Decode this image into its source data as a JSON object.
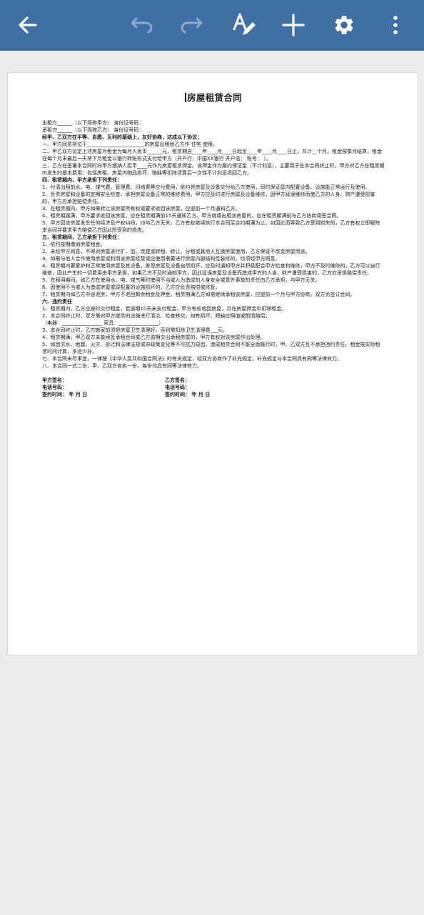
{
  "toolbar": {
    "icons": [
      "back-arrow-icon",
      "undo-icon",
      "redo-icon",
      "text-format-icon",
      "add-icon",
      "gear-icon",
      "more-vert-icon"
    ],
    "color": "#3f6fa3"
  },
  "document": {
    "title": "房屋租赁合同",
    "lines": [
      {
        "t": "出租方______（以下简称甲方）  身份证号码：",
        "b": false
      },
      {
        "t": "承租方______（以下简称乙方）  身份证号码：",
        "b": false
      },
      {
        "t": "经甲、乙双方在平等、自愿、互利的基础上，友好协商，达成以下协议：",
        "b": true
      },
      {
        "t": "一、甲方同意将位于_______________________的房屋出租给乙方作 住宅 使用。",
        "b": false
      },
      {
        "t": "二、甲乙双方议定上述房屋月租金为每月人民币______元，租赁期自____年____月____日起至____年____月____日止，共计__个月。租金按季月结算，租金在每个月末最后一天将下月租金以银行转账形式支付给甲方（开户行：中国XX银行  开户名：    账号：                ）。",
        "b": false
      },
      {
        "t": "三、乙方在签署本合同时向甲方缴纳人民币____元作为房屋租赁押金。该押金作为履约保证金（不计利息），主要用于在本合同终止时，甲方对乙方在租赁期内发生的基本费用：包括房租、房屋内物品损坏、赔缺等扣除清算后一次性不计利息退回乙方。",
        "b": false
      },
      {
        "t": "四、租赁期内，甲方承担下列责任：",
        "b": true
      },
      {
        "t": "1、付清出租前水、电、煤气费、管理费、间络费等应付费用，依约将房屋及设备交付给乙方使用，同时保证屋内配置设备、设施能正常运行及使用。",
        "b": false
      },
      {
        "t": "2、负责房屋和设备的定期安全检查，承担房屋设备正常的维修费用。甲方应及时进行房屋及设备维修，因甲方延误维修而使乙方的人身、财产遭受损害的，甲方应承担赔偿责任。",
        "b": false
      },
      {
        "t": "3、在租赁期内，甲方如需转让该房屋所有权或要求收回该房屋，应提前一个月通知乙方。",
        "b": false
      },
      {
        "t": "4、租赁期届满，甲方要求收回该房屋，应在租赁期满前15天通知乙方。甲方继续出租该房屋的，应在租赁期满前与乙方协商续签合同。",
        "b": false
      },
      {
        "t": "5、甲方因该房屋发生任何经济及产权纠纷，均与乙方无关，乙方有权继续执行本合同至合约期满为止。如因此而导致乙方受到损失的，乙方有权立即解除本合同并要求甲方赔偿乙方因此所受到的损失。",
        "b": false
      },
      {
        "t": "五、租赁期间，乙方承担下列责任：",
        "b": true
      },
      {
        "t": "1、依约按期缴纳房屋租金。",
        "b": false
      },
      {
        "t": "2、未经甲方同意，不得对房屋进行扩、加、改建或转租、转让、分租或其他人互换房屋使用，乙方保证不改变房屋用途。",
        "b": false
      },
      {
        "t": "3、如需与他人合作使用房屋或利用该房屋经营或应使用需要进行房屋内部结构性装修的，均须经甲方同意。",
        "b": false
      },
      {
        "t": "4、租赁期内要爱护和正常使用房屋及其设备，发现房屋及设备自然损坏，应及时通知甲方并积极配合甲方检查和维修，甲方不及时维修的，乙方可以自行维修，因此产生的一切费用由甲方承担，如果乙方不及时通知甲方，因此延误房屋及设备而造成甲方的人身、财产遭受损害的，乙方应承担赔偿责任。",
        "b": false
      },
      {
        "t": "5、在租用期间，如乙方在使用水、电、煤气等时使用不当或人为造成的人身安全或意外事故的责任由乙方承担，与甲方无关。",
        "b": false
      },
      {
        "t": "6、因使用不当或人为造成房屋或原配置的设施损坏的，乙方应负责赔偿或修复。",
        "b": false
      },
      {
        "t": "7、租赁期内如乙方中途退房，甲方不退回剩余租金及押金。租赁期满乙方如需继续承租该房屋，应提前一个月与甲方协商，双方另签订合同。",
        "b": false
      },
      {
        "t": "六、违约责任",
        "b": true
      },
      {
        "t": "1、租赁期内，乙方应按时交付租金，若逾期10天未支付租金，甲方有权收回房屋，并在房屋押金中扣除租金。",
        "b": false
      },
      {
        "t": "2、本合同终止时，双方需对甲方提供的设施进行清点、检查移交，如有损坏、短缺应照值或酌情赔偿；",
        "b": false
      },
      {
        "t": "（电器：________________ 家具：________________）",
        "b": false
      },
      {
        "t": "3、本合同终止时，乙方搬家前须把房屋卫生清理好，否则需扣除卫生清理费___元。",
        "b": false
      },
      {
        "t": "4、租赁期满，甲乙双方未能续签承租合同或乙方逾期交出承租房屋的，甲方有权对该房屋作出处理。",
        "b": false
      },
      {
        "t": "5、如因洪水、地震、火灾、拆迁和法律法规或府政策变化等不可抗力原因，造成租赁合同不能全面履行时，甲、乙双方互不承担违约责任。租金按实际租赁时间计算，多退少补。",
        "b": false
      },
      {
        "t": "七、本合同未尽事宜，一律按《中华人民共和国合同法》的有关规定，经双方协商作了补充规定，补充规定与本合同具有同等法律效力。",
        "b": false
      },
      {
        "t": "八、本合同一式二份，甲、乙双方各执一份，每份均具有同等法律效力。",
        "b": false
      }
    ],
    "signatures": {
      "party_a_sign": "甲方签名：",
      "party_a_phone": "电话号码：",
      "party_a_date": "签约时间：  年  月  日",
      "party_b_sign": "乙方签名：",
      "party_b_phone": "电话号码：",
      "party_b_date": "签约时间：  年  月  日"
    }
  }
}
